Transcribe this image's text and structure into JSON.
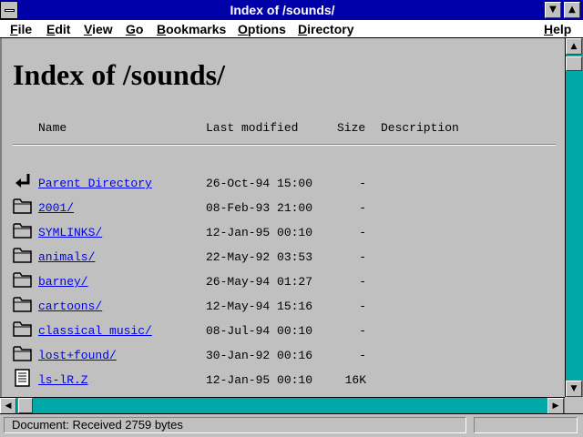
{
  "window": {
    "title": "Index of /sounds/"
  },
  "titlebar_buttons": {
    "minimize": "▼",
    "maximize": "▲"
  },
  "menu": [
    {
      "label": "File"
    },
    {
      "label": "Edit"
    },
    {
      "label": "View"
    },
    {
      "label": "Go"
    },
    {
      "label": "Bookmarks"
    },
    {
      "label": "Options"
    },
    {
      "label": "Directory"
    },
    {
      "label": "Help"
    }
  ],
  "page": {
    "heading": "Index of /sounds/",
    "columns": {
      "name": "Name",
      "modified": "Last modified",
      "size": "Size",
      "description": "Description"
    },
    "entries": [
      {
        "icon": "back-arrow-icon",
        "name": "Parent Directory",
        "modified": "26-Oct-94 15:00",
        "size": "-"
      },
      {
        "icon": "folder-icon",
        "name": "2001/",
        "modified": "08-Feb-93 21:00",
        "size": "-"
      },
      {
        "icon": "folder-icon",
        "name": "SYMLINKS/",
        "modified": "12-Jan-95 00:10",
        "size": "-"
      },
      {
        "icon": "folder-icon",
        "name": "animals/",
        "modified": "22-May-92 03:53",
        "size": "-"
      },
      {
        "icon": "folder-icon",
        "name": "barney/",
        "modified": "26-May-94 01:27",
        "size": "-"
      },
      {
        "icon": "folder-icon",
        "name": "cartoons/",
        "modified": "12-May-94 15:16",
        "size": "-"
      },
      {
        "icon": "folder-icon",
        "name": "classical music/",
        "modified": "08-Jul-94 00:10",
        "size": "-"
      },
      {
        "icon": "folder-icon",
        "name": "lost+found/",
        "modified": "30-Jan-92 00:16",
        "size": "-"
      },
      {
        "icon": "document-icon",
        "name": "ls-lR.Z",
        "modified": "12-Jan-95 00:10",
        "size": "16K"
      }
    ]
  },
  "scrollbar": {
    "up": "▲",
    "down": "▼",
    "left": "◀",
    "right": "▶"
  },
  "status": {
    "text": "Document: Received 2759 bytes"
  },
  "colors": {
    "titlebar": "#0000a8",
    "link": "#0000ee",
    "scroll_track": "#00a8a8",
    "face": "#c0c0c0"
  }
}
